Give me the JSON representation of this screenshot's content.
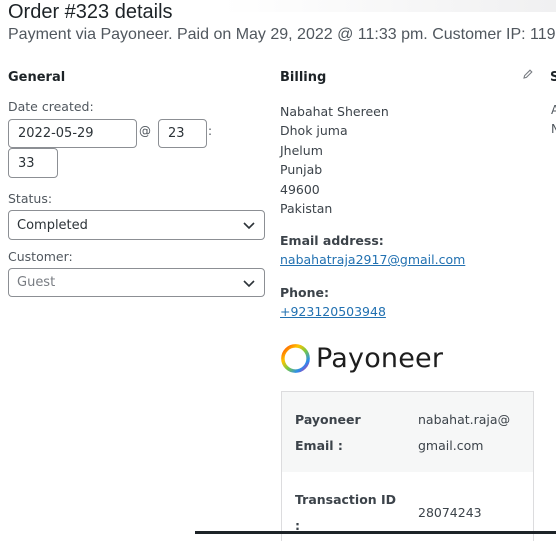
{
  "header": {
    "title": "Order #323 details",
    "subtitle": "Payment via Payoneer. Paid on May 29, 2022 @ 11:33 pm. Customer IP: 119"
  },
  "general": {
    "heading": "General",
    "date_label": "Date created:",
    "date_value": "2022-05-29",
    "at_sep": "@",
    "hour_value": "23",
    "colon_sep": ":",
    "minute_value": "33",
    "status_label": "Status:",
    "status_value": "Completed",
    "customer_label": "Customer:",
    "customer_placeholder": "Guest"
  },
  "billing": {
    "heading": "Billing",
    "name": "Nabahat Shereen",
    "address_1": "Dhok juma",
    "city": "Jhelum",
    "state": "Punjab",
    "postcode": "49600",
    "country": "Pakistan",
    "email_label": "Email address:",
    "email": "nabahatraja2917@gmail.com",
    "phone_label": "Phone:",
    "phone": "+923120503948"
  },
  "payoneer": {
    "logo_text": "Payoneer",
    "email_label_line1": "Payoneer",
    "email_label_line2": "Email :",
    "email_value_line1": "nabahat.raja@",
    "email_value_line2": "gmail.com",
    "txn_label_line1": "Transaction ID",
    "txn_label_line2": ":",
    "txn_value": "28074243"
  },
  "shipping": {
    "heading_partial": "S",
    "line1_partial": "A",
    "line2_partial": "N"
  },
  "colors": {
    "link": "#2271b1",
    "border": "#8c8f94",
    "text": "#3c434a"
  }
}
